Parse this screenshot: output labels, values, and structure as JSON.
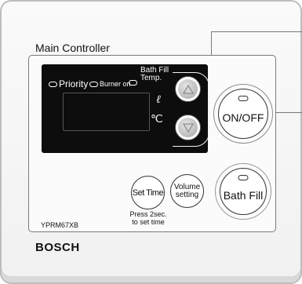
{
  "controller_title": "Main Controller",
  "display": {
    "indicator_priority": "Priority",
    "indicator_burner": "Burner on",
    "indicator_bathfill_line1": "Bath Fill",
    "indicator_bathfill_line2": "Temp.",
    "unit_liter": "ℓ",
    "unit_celsius": "℃"
  },
  "buttons": {
    "up_icon": "up-triangle-icon",
    "down_icon": "down-triangle-icon",
    "onoff_label": "ON/OFF",
    "bathfill_label": "Bath Fill",
    "settime_label": "Set Time",
    "volume_line1": "Volume",
    "volume_line2": "setting"
  },
  "press_note_line1": "Press 2sec.",
  "press_note_line2": "to set time",
  "model": "YPRM67XB",
  "brand": "BOSCH",
  "colors": {
    "display_bg": "#0d0d0d",
    "arrow_button": "#a8a8a8",
    "device_bg": "#f4f4f4"
  }
}
